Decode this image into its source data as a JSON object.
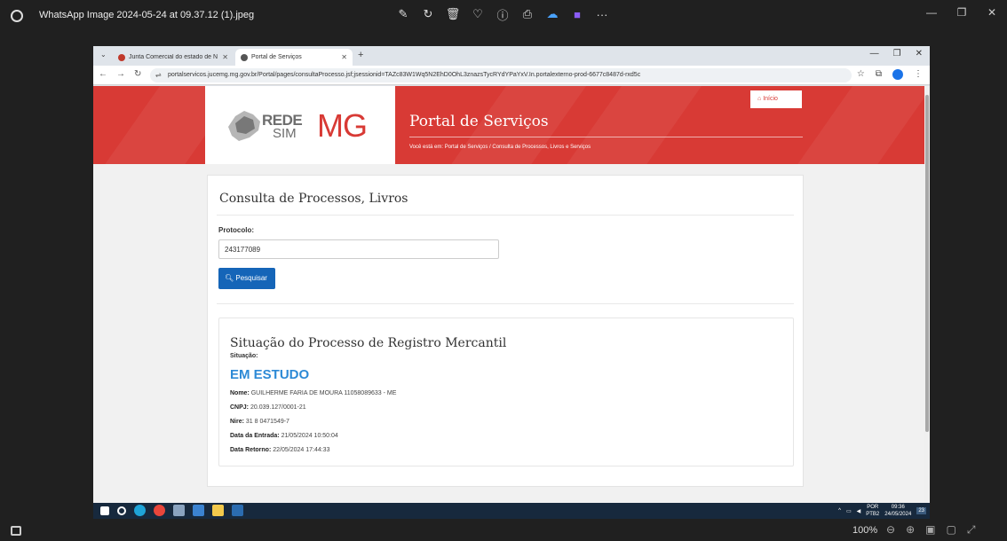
{
  "viewer": {
    "title": "WhatsApp Image 2024-05-24 at 09.37.12 (1).jpeg",
    "zoom": "100%",
    "tools": [
      "edit-icon",
      "rotate-icon",
      "delete-icon",
      "heart-icon",
      "info-icon",
      "print-icon",
      "cloud-icon",
      "clipchamp-icon",
      "more-icon"
    ]
  },
  "browser": {
    "tabs": [
      {
        "label": "Junta Comercial do estado de N",
        "active": false
      },
      {
        "label": "Portal de Serviços",
        "active": true
      }
    ],
    "url": "portalservicos.jucemg.mg.gov.br/Portal/pages/consultaProcesso.jsf;jsessionid=TAZc83W1Wq5N2EhD0OhL3znazsTycRYdYPaYxV.In.portalexterno-prod-6677c8487d-rxd5c"
  },
  "header": {
    "logo_rede": "REDE",
    "logo_sim": "SIM",
    "logo_mg": "MG",
    "title": "Portal de Serviços",
    "breadcrumb": "Você está em: Portal de Serviços / Consulta de Processos, Livros e Serviços",
    "inicio": "Início",
    "brand_color": "#d83a35"
  },
  "content": {
    "title": "Consulta de Processos, Livros",
    "protocolo_label": "Protocolo:",
    "protocolo_value": "243177089",
    "search_button": "Pesquisar"
  },
  "situacao": {
    "title": "Situação do Processo de Registro Mercantil",
    "label": "Situação:",
    "status": "EM ESTUDO",
    "fields": [
      {
        "label": "Nome:",
        "value": "GUILHERME FARIA DE MOURA 11058089633 - ME"
      },
      {
        "label": "CNPJ:",
        "value": "20.039.127/0001-21"
      },
      {
        "label": "Nire:",
        "value": "31 8 0471549-7"
      },
      {
        "label": "Data da Entrada:",
        "value": "21/05/2024 10:50:04"
      },
      {
        "label": "Data Retorno:",
        "value": "22/05/2024 17:44:33"
      }
    ]
  },
  "taskbar": {
    "lang": "POR",
    "layout": "PTB2",
    "time": "09:36",
    "date": "24/05/2024",
    "badge": "23"
  }
}
